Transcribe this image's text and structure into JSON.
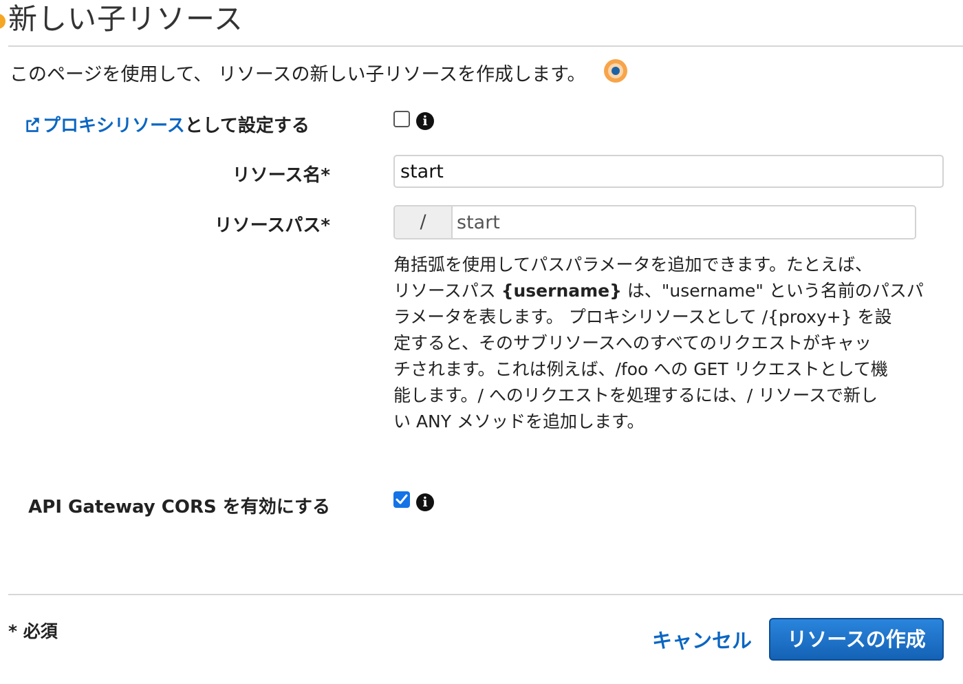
{
  "page": {
    "title": "新しい子リソース",
    "intro": "このページを使用して、 リソースの新しい子リソースを作成します。"
  },
  "proxy": {
    "link_text": "プロキシリソース",
    "suffix_text": "として設定する",
    "checked": false
  },
  "resource_name": {
    "label": "リソース名*",
    "value": "start"
  },
  "resource_path": {
    "label": "リソースパス*",
    "prefix": "/",
    "value": "start"
  },
  "help": {
    "line1": "角括弧を使用してパスパラメータを追加できます。たとえば、",
    "line2_pre": "リソースパス ",
    "line2_bold": "{username}",
    "line2_post": " は、\"username\" という名前のパスパ",
    "line3": "ラメータを表します。 プロキシリソースとして /{proxy+} を設",
    "line4": "定すると、そのサブリソースへのすべてのリクエストがキャッ",
    "line5": "チされます。これは例えば、/foo への GET リクエストとして機",
    "line6": "能します。/ へのリクエストを処理するには、/ リソースで新し",
    "line7": "い ANY メソッドを追加します。"
  },
  "cors": {
    "label": "API Gateway CORS を有効にする",
    "checked": true
  },
  "footer": {
    "required_note": "* 必須",
    "cancel_label": "キャンセル",
    "create_label": "リソースの作成"
  },
  "colors": {
    "link": "#0b66c2",
    "primary_button": "#1d6fc7",
    "checkbox_checked": "#1473e6",
    "accent_dot": "#f5a623"
  },
  "icons": [
    "external-link-icon",
    "info-icon",
    "checkmark-icon",
    "status-dot-icon"
  ]
}
